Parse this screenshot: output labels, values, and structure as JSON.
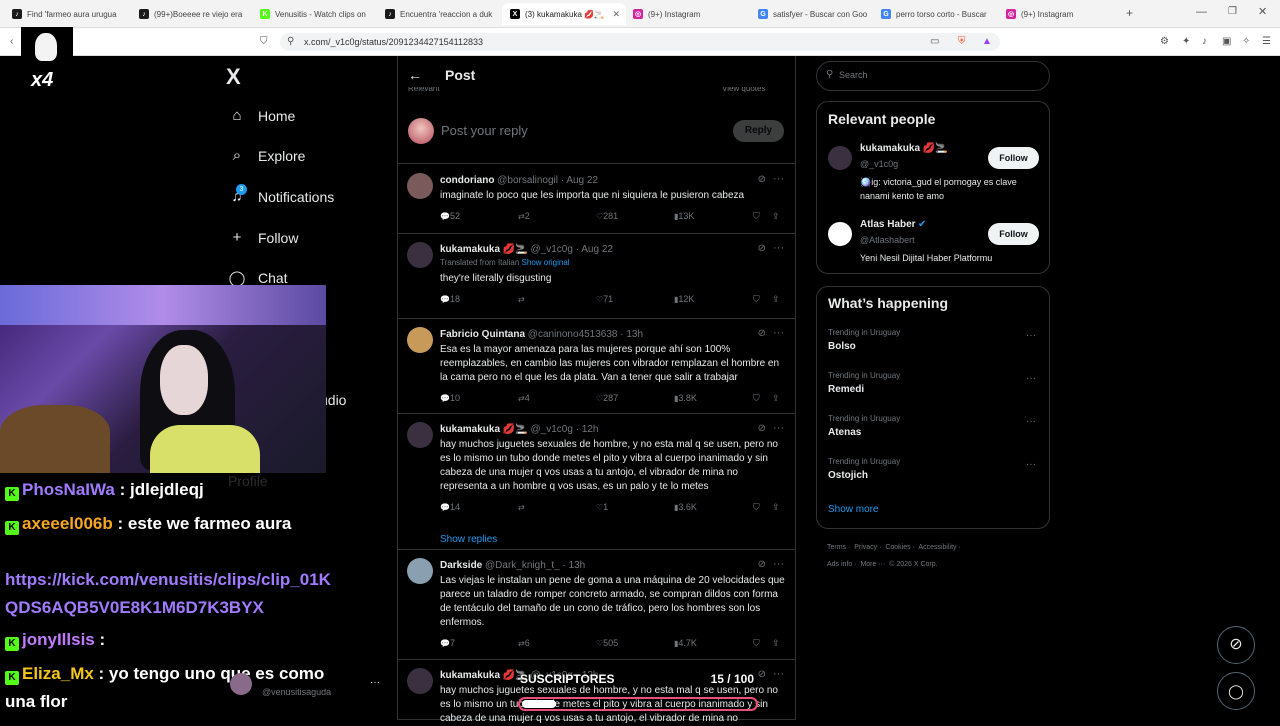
{
  "browser": {
    "tabs": [
      {
        "title": "Find 'farmeo aura urugua",
        "fav_color": "#1a1a1a",
        "fav": "♪"
      },
      {
        "title": "(99+)Boeeee re viejo era",
        "fav_color": "#1a1a1a",
        "fav": "♪"
      },
      {
        "title": "Venusitis - Watch clips on",
        "fav_color": "#53fc18",
        "fav": "K"
      },
      {
        "title": "Encuentra 'reaccion a duk",
        "fav_color": "#1a1a1a",
        "fav": "♪"
      },
      {
        "title": "(3) kukamakuka 💋🚬",
        "fav_color": "#000",
        "fav": "X"
      },
      {
        "title": "(9+) Instagram",
        "fav_color": "#d6249f",
        "fav": "◎"
      },
      {
        "title": "satisfyer - Buscar con Goo",
        "fav_color": "#4285f4",
        "fav": "G"
      },
      {
        "title": "perro torso corto - Buscar",
        "fav_color": "#4285f4",
        "fav": "G"
      },
      {
        "title": "(9+) Instagram",
        "fav_color": "#d6249f",
        "fav": "◎"
      }
    ],
    "url": "x.com/_v1c0g/status/2091234427154112833"
  },
  "x": {
    "logo": "X",
    "nav": [
      {
        "label": "Home",
        "icon": "⌂"
      },
      {
        "label": "Explore",
        "icon": "⌕"
      },
      {
        "label": "Notifications",
        "icon": "♫",
        "badge": "3"
      },
      {
        "label": "Follow",
        "icon": "+"
      },
      {
        "label": "Chat",
        "icon": "◯"
      },
      {
        "label": "udio",
        "icon": ""
      },
      {
        "label": "Profile",
        "icon": ""
      }
    ],
    "header": {
      "title": "Post",
      "left_frag": "Relevant",
      "right_frag": "View quotes"
    },
    "reply": {
      "placeholder": "Post your reply",
      "button": "Reply"
    },
    "tweets": [
      {
        "name": "condoriano",
        "handle": "@borsalinogil",
        "time": "Aug 22",
        "translated": "",
        "show_original": "",
        "text": "imaginate lo poco que les importa que ni siquiera le pusieron cabeza",
        "replies": "52",
        "retweets": "2",
        "likes": "281",
        "views": "13K",
        "show_replies": ""
      },
      {
        "name": "kukamakuka 💋🚬",
        "handle": "@_v1c0g",
        "time": "Aug 22",
        "translated": "Translated from Italian",
        "show_original": "Show original",
        "text": "they're literally disgusting",
        "replies": "18",
        "retweets": "",
        "likes": "71",
        "views": "12K",
        "show_replies": ""
      },
      {
        "name": "Fabricio Quintana",
        "handle": "@caninono4513638",
        "time": "13h",
        "translated": "",
        "show_original": "",
        "text": "Esa es la mayor amenaza para las mujeres porque ahí son 100% reemplazables, en cambio las mujeres con vibrador remplazan el hombre en la cama pero no el que les da plata. Van a tener que salir a trabajar",
        "replies": "10",
        "retweets": "4",
        "likes": "287",
        "views": "3.8K",
        "show_replies": ""
      },
      {
        "name": "kukamakuka 💋🚬",
        "handle": "@_v1c0g",
        "time": "12h",
        "translated": "",
        "show_original": "",
        "text": "hay muchos juguetes sexuales de hombre, y no esta mal q se usen, pero no es lo mismo un tubo donde metes el pito y vibra al cuerpo inanimado y sin cabeza de una mujer q vos usas a tu antojo, el vibrador de mina no representa a un hombre q vos usas, es un palo y te lo metes",
        "replies": "14",
        "retweets": "",
        "likes": "1",
        "views": "3.6K",
        "show_replies": "Show replies"
      },
      {
        "name": "Darkside",
        "handle": "@Dark_knigh_t_",
        "time": "13h",
        "translated": "",
        "show_original": "",
        "text": "Las viejas le instalan un pene de goma a una máquina  de 20 velocidades que parece un taladro de romper concreto armado, se compran dildos con forma de tentáculo del tamaño de un cono de tráfico, pero los hombres son los enfermos.",
        "replies": "7",
        "retweets": "6",
        "likes": "505",
        "views": "4.7K",
        "show_replies": ""
      },
      {
        "name": "kukamakuka 💋🚬",
        "handle": "@_v1c0g",
        "time": "12h",
        "translated": "",
        "show_original": "",
        "text": "hay muchos juguetes sexuales de hombre, y no esta mal q se usen, pero no es lo mismo un tubo donde metes el pito y vibra al cuerpo inanimado y sin cabeza de una mujer q vos usas a tu antojo, el vibrador de mina no",
        "replies": "",
        "retweets": "",
        "likes": "",
        "views": "",
        "show_replies": ""
      }
    ],
    "search": {
      "placeholder": "Search"
    },
    "relevant": {
      "title": "Relevant people",
      "people": [
        {
          "name": "kukamakuka 💋🚬",
          "handle": "@_v1c0g",
          "bio": "🪩ig: victoria_gud el pornogay es clave nanami kento te amo",
          "follow": "Follow"
        },
        {
          "name": "Atlas Haber",
          "handle": "@Atlashabert",
          "bio": "Yeni Nesil Dijital Haber Platformu",
          "follow": "Follow"
        }
      ]
    },
    "happening": {
      "title": "What’s happening",
      "trends": [
        {
          "context": "Trending in Uruguay",
          "topic": "Bolso"
        },
        {
          "context": "Trending in Uruguay",
          "topic": "Remedi"
        },
        {
          "context": "Trending in Uruguay",
          "topic": "Atenas"
        },
        {
          "context": "Trending in Uruguay",
          "topic": "Ostojich"
        }
      ],
      "show_more": "Show more"
    },
    "footer": {
      "line1": "Terms ·  Privacy ·  Cookies ·  Accessibility ·",
      "line2": "Ads info ·  More ···  © 2026 X Corp."
    },
    "account_handle": "@venusitisaguda"
  },
  "stream": {
    "logo_text": "x4",
    "subs_label": "SUSCRIPTORES",
    "subs_count": "15 / 100",
    "chat": [
      {
        "user": "PhosNaIWa",
        "user_color": "#a17bff",
        "msg": ": jdlejdleqj"
      },
      {
        "user": "axeeel006b",
        "user_color": "#f5a623",
        "msg": ": este we farmeo aura"
      },
      {
        "user": "",
        "user_color": "#a17bff",
        "msg": "https://kick.com/venusitis/clips/clip_01KQDS6AQB5V0E8K1M6D7K3BYX"
      },
      {
        "user": "jonyIllsis",
        "user_color": "#c27bff",
        "msg": ":"
      },
      {
        "user": "Eliza_Mx",
        "user_color": "#f5c518",
        "msg": ": yo tengo uno que es como una flor"
      }
    ]
  }
}
